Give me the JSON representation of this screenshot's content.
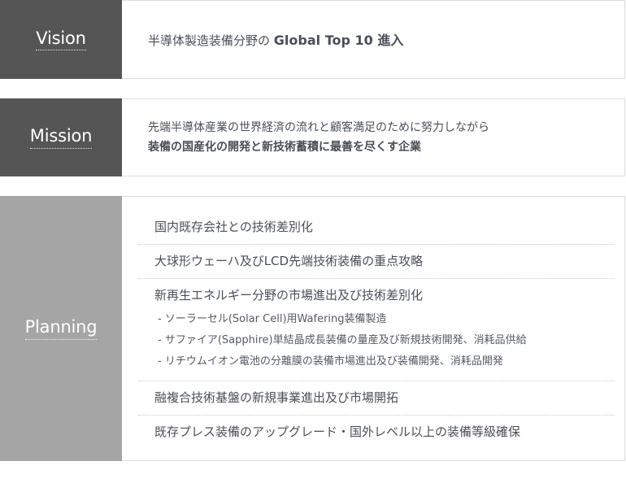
{
  "vision": {
    "label": "Vision",
    "text_regular": "半導体製造装備分野の",
    "text_strong": "Global Top 10 進入"
  },
  "mission": {
    "label": "Mission",
    "line1": "先端半導体産業の世界経済の流れと顧客満足のために努力しながら",
    "line2": "装備の国産化の開発と新技術蓄積に最善を尽くす企業"
  },
  "planning": {
    "label": "Planning",
    "items": [
      {
        "title": "国内既存会社との技術差別化"
      },
      {
        "title": "大球形ウェーハ及びLCD先端技術装備の重点攻略"
      },
      {
        "title": "新再生エネルギー分野の市場進出及び技術差別化",
        "subs": [
          "- ソーラーセル(Solar Cell)用Wafering装備製造",
          "- サファイア(Sapphire)単結晶成長装備の量産及び新規技術開発、消耗品供給",
          "- リチウムイオン電池の分離膜の装備市場進出及び装備開発、消耗品開発"
        ]
      },
      {
        "title": "融複合技術基盤の新規事業進出及び市場開拓"
      },
      {
        "title": "既存プレス装備のアップグレード・国外レベル以上の装備等級確保"
      }
    ]
  },
  "colors": {
    "dark_label_bg": "#555555",
    "light_label_bg": "#a5a5a5",
    "text": "#4a4f57",
    "border": "#dcdcdc"
  }
}
